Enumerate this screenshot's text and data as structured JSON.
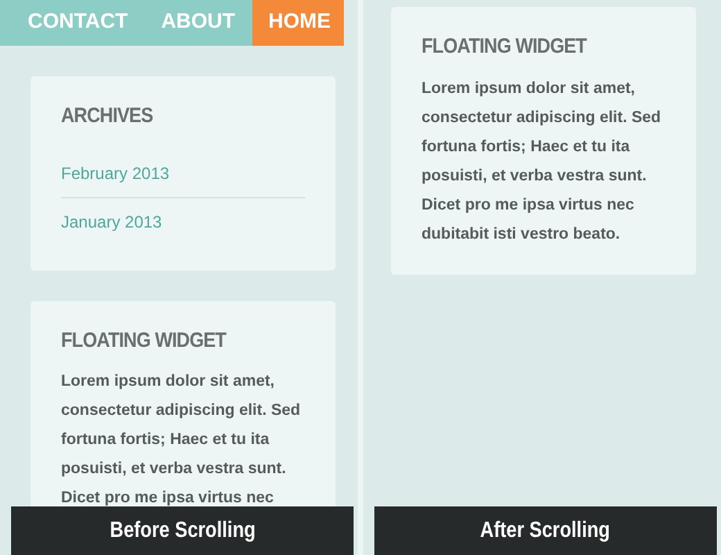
{
  "panes": [
    {
      "nav": [
        {
          "label": "CONTACT",
          "selected": false
        },
        {
          "label": "ABOUT",
          "selected": false
        },
        {
          "label": "HOME",
          "selected": true
        }
      ],
      "widgets": [
        {
          "kind": "links",
          "title": "ARCHIVES",
          "links": [
            "February 2013",
            "January 2013"
          ]
        },
        {
          "kind": "text",
          "title": "FLOATING WIDGET",
          "body": "Lorem ipsum dolor sit amet, consectetur adipiscing elit. Sed fortuna fortis; Haec et tu ita posuisti, et verba vestra sunt. Dicet pro me ipsa virtus nec"
        }
      ],
      "caption": "Before Scrolling"
    },
    {
      "widgets": [
        {
          "kind": "text",
          "title": "FLOATING WIDGET",
          "body": "Lorem ipsum dolor sit amet, consectetur adipiscing elit. Sed fortuna fortis; Haec et tu ita posuisti, et verba vestra sunt. Dicet pro me ipsa virtus nec dubitabit isti vestro beato."
        }
      ],
      "caption": "After Scrolling"
    }
  ]
}
